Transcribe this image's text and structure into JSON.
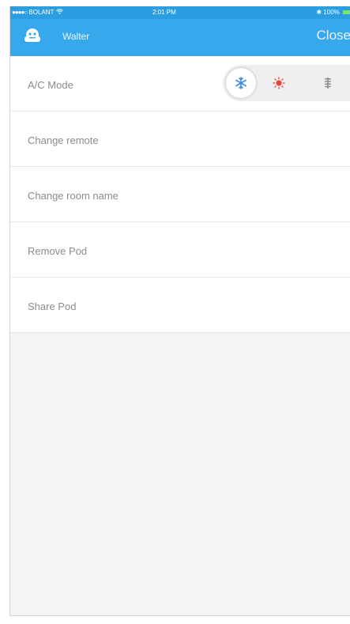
{
  "status_bar": {
    "carrier": "BOLANT",
    "time": "2:01 PM",
    "battery": "100%"
  },
  "nav": {
    "title": "Walter",
    "close_label": "Close"
  },
  "menu": {
    "ac_mode": {
      "label": "A/C Mode",
      "modes": [
        "cool",
        "heat",
        "fan"
      ],
      "selected": "cool"
    },
    "items": [
      {
        "label": "Change remote"
      },
      {
        "label": "Change room name"
      },
      {
        "label": "Remove Pod"
      },
      {
        "label": "Share Pod"
      }
    ]
  },
  "colors": {
    "status_bar": "#2b9de0",
    "nav_bar": "#38a8ec",
    "cool_icon": "#3b8fe0",
    "heat_icon": "#e9433b",
    "fan_icon": "#8f8f8f"
  },
  "icons": {
    "avatar": "pod-avatar-icon",
    "cool": "snowflake-icon",
    "heat": "sun-icon",
    "fan": "fan-icon"
  }
}
